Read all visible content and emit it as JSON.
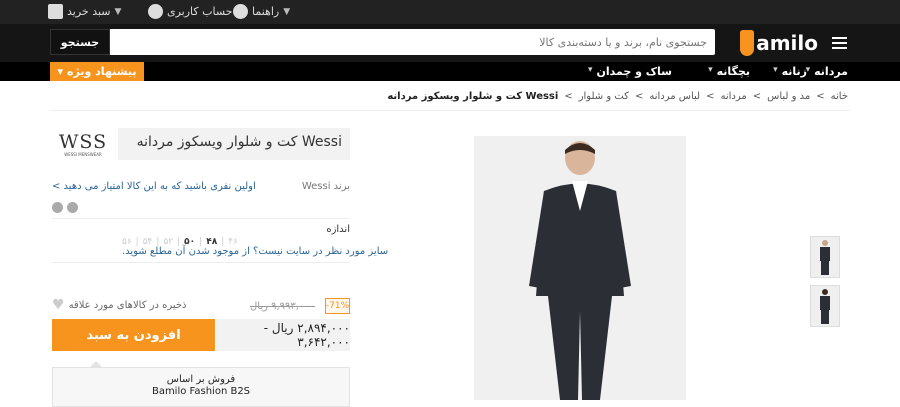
{
  "topbar": {
    "cart_label": "سبد خرید",
    "account_label": "حساب کاربری",
    "help_label": "راهنما"
  },
  "header": {
    "logo_text": "amilo",
    "search_placeholder": "جستجوی نام، برند و یا دسته‌بندی کالا",
    "search_button": "جستجو"
  },
  "nav": {
    "categories": [
      "مردانه",
      "زنانه",
      "بچگانه",
      "ساک و چمدان"
    ],
    "special_offer": "پیشنهاد ویژه"
  },
  "breadcrumb": [
    "خانه",
    "مد و لباس",
    "مردانه",
    "لباس مردانه",
    "کت و شلوار",
    "Wessi کت و شلوار ویسکوز مردانه"
  ],
  "product": {
    "title": "Wessi کت و شلوار ویسکوز مردانه",
    "brand_logo_text": "WSS",
    "brand_logo_sub": "WESSI MENSWEAR",
    "brand_line": "برند Wessi",
    "rate_link": "اولین نفری باشید که به این کالا امتیاز می دهید >",
    "size_label": "اندازه",
    "sizes": [
      "۴۶",
      "۴۸",
      "۵۰",
      "۵۲",
      "۵۴",
      "۵۶"
    ],
    "selected_size": "۴۸",
    "size_note": "سایز مورد نظر در سایت نیست؟ از موجود شدن آن مطلع شوید.",
    "favorite_label": "ذخیره در کالاهای مورد علاقه",
    "discount": "-71%",
    "old_price": "۹,۹۹۳,۰۰۰ ریال",
    "price_range": "۲,۸۹۴,۰۰۰ ریال - ۳,۶۴۲,۰۰۰",
    "add_to_cart": "افزودن به سبد",
    "ship_line1": "فروش بر اساس",
    "ship_line2": "Bamilo Fashion B2S"
  },
  "colors": {
    "accent": "#f7941d",
    "topbar_bg": "#222222",
    "header_bg": "#151515",
    "nav_bg": "#000000",
    "link": "#2a6496"
  },
  "icons": [
    "cart-icon",
    "account-icon",
    "help-icon",
    "menu-icon",
    "heart-icon",
    "facebook-icon",
    "twitter-icon"
  ]
}
